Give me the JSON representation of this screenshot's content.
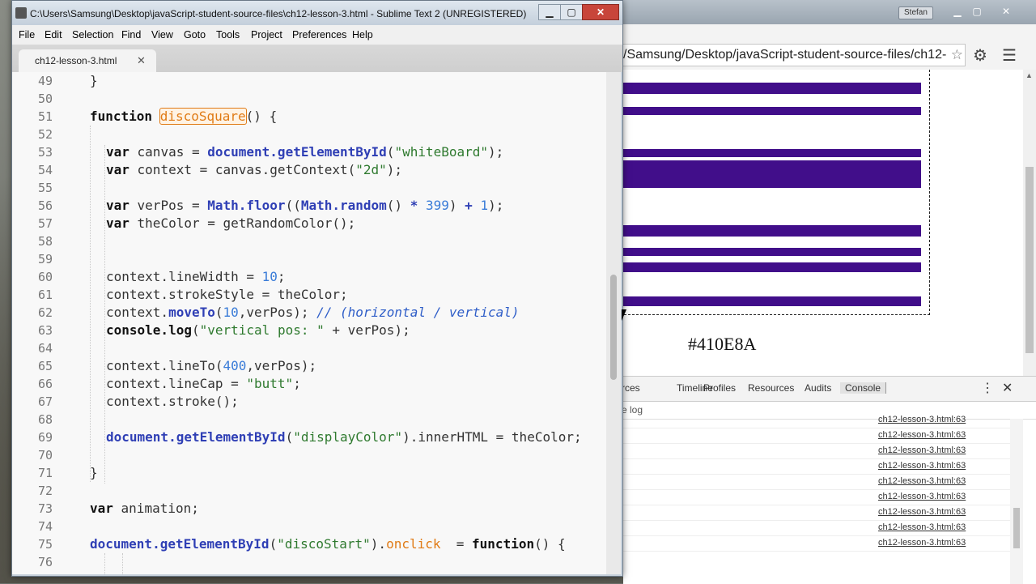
{
  "sublime": {
    "title": "C:\\Users\\Samsung\\Desktop\\javaScript-student-source-files\\ch12-lesson-3.html - Sublime Text 2 (UNREGISTERED)",
    "menu": [
      "File",
      "Edit",
      "Selection",
      "Find",
      "View",
      "Goto",
      "Tools",
      "Project",
      "Preferences",
      "Help"
    ],
    "tab_name": "ch12-lesson-3.html",
    "tab_close": "✕",
    "lines": [
      {
        "n": "49"
      },
      {
        "n": "50"
      },
      {
        "n": "51"
      },
      {
        "n": "52"
      },
      {
        "n": "53"
      },
      {
        "n": "54"
      },
      {
        "n": "55"
      },
      {
        "n": "56"
      },
      {
        "n": "57"
      },
      {
        "n": "58"
      },
      {
        "n": "59"
      },
      {
        "n": "60"
      },
      {
        "n": "61"
      },
      {
        "n": "62"
      },
      {
        "n": "63"
      },
      {
        "n": "64"
      },
      {
        "n": "65"
      },
      {
        "n": "66"
      },
      {
        "n": "67"
      },
      {
        "n": "68"
      },
      {
        "n": "69"
      },
      {
        "n": "70"
      },
      {
        "n": "71"
      },
      {
        "n": "72"
      },
      {
        "n": "73"
      },
      {
        "n": "74"
      },
      {
        "n": "75"
      },
      {
        "n": "76"
      }
    ]
  },
  "code": {
    "l49": "}",
    "l51_kw": "function",
    "l51_name": "discoSquare",
    "l51_rest": "() {",
    "l53_kw": "var",
    "l53_a": " canvas = ",
    "l53_fn": "document.getElementById",
    "l53_b": "(",
    "l53_str": "\"whiteBoard\"",
    "l53_c": ");",
    "l54_kw": "var",
    "l54_a": " context = canvas.getContext(",
    "l54_str": "\"2d\"",
    "l54_b": ");",
    "l56_kw": "var",
    "l56_a": " verPos = ",
    "l56_fn1": "Math.floor",
    "l56_b": "((",
    "l56_fn2": "Math.random",
    "l56_c": "() ",
    "l56_op": "*",
    "l56_d": " ",
    "l56_n1": "399",
    "l56_e": ") ",
    "l56_op2": "+",
    "l56_f": " ",
    "l56_n2": "1",
    "l56_g": ");",
    "l57_kw": "var",
    "l57_a": " theColor = getRandomColor();",
    "l60_a": "context.lineWidth = ",
    "l60_n": "10",
    "l60_b": ";",
    "l61": "context.strokeStyle = theColor;",
    "l62_a": "context.",
    "l62_fn": "moveTo",
    "l62_b": "(",
    "l62_n": "10",
    "l62_c": ",verPos); ",
    "l62_com": "// (horizontal / vertical)",
    "l63_kw": "console.log",
    "l63_a": "(",
    "l63_str": "\"vertical pos: \"",
    "l63_b": " + verPos);",
    "l65_a": "context.lineTo(",
    "l65_n": "400",
    "l65_b": ",verPos);",
    "l66_a": "context.lineCap = ",
    "l66_str": "\"butt\"",
    "l66_b": ";",
    "l67": "context.stroke();",
    "l69_fn": "document.getElementById",
    "l69_a": "(",
    "l69_str": "\"displayColor\"",
    "l69_b": ").innerHTML = theColor;",
    "l71": "}",
    "l73_kw": "var",
    "l73_a": " animation;",
    "l75_fn": "document.getElementById",
    "l75_a": "(",
    "l75_str": "\"discoStart\"",
    "l75_b": ").",
    "l75_ev": "onclick",
    "l75_c": "  = ",
    "l75_kw": "function",
    "l75_d": "() {"
  },
  "browser": {
    "user": "Stefan",
    "url": "/Samsung/Desktop/javaScript-student-source-files/ch12-",
    "display_color": "#410E8A",
    "stripe_color": "#410E8A",
    "devtools_tabs": [
      "rces",
      "Timeline",
      "Profiles",
      "Resources",
      "Audits",
      "Console"
    ],
    "filter_text": "e log",
    "log_source": "ch12-lesson-3.html:63",
    "log_lines": 9
  }
}
